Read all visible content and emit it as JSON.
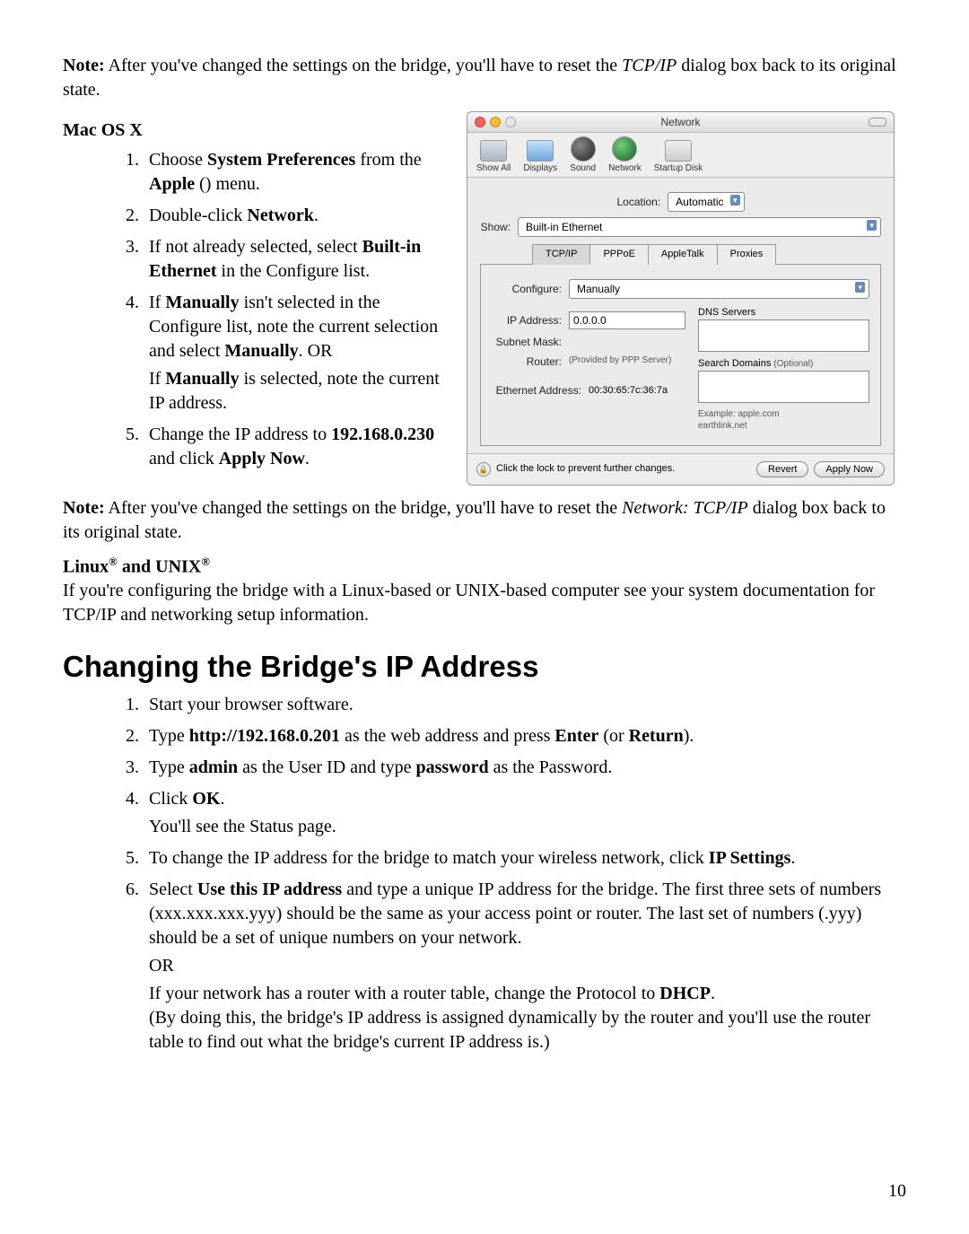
{
  "note1_prefix": "Note:",
  "note1_body": " After you've changed the settings on the bridge, you'll have to reset the ",
  "note1_italic": "TCP/IP",
  "note1_tail": " dialog box back to its original state.",
  "mac_hdr": "Mac OS X",
  "mac_steps_1a": "Choose ",
  "mac_steps_1b": "System Preferences",
  "mac_steps_1c": " from the ",
  "mac_steps_1d": "Apple",
  "mac_steps_1e": " (",
  "mac_steps_1f": ") menu.",
  "mac_steps_2a": "Double-click ",
  "mac_steps_2b": "Network",
  "mac_steps_2c": ".",
  "mac_steps_3a": "If not already selected, select ",
  "mac_steps_3b": "Built-in Ethernet",
  "mac_steps_3c": " in the Configure list.",
  "mac_steps_4a": "If ",
  "mac_steps_4b": "Manually",
  "mac_steps_4c": " isn't selected in the Configure list, note the current selection and select ",
  "mac_steps_4d": "Manually",
  "mac_steps_4e": ". OR",
  "mac_steps_4f": "If ",
  "mac_steps_4g": "Manually",
  "mac_steps_4h": " is selected, note the current IP address.",
  "mac_steps_5a": "Change the IP address to ",
  "mac_steps_5b": "192.168.0.230",
  "mac_steps_5c": " and click ",
  "mac_steps_5d": "Apply Now",
  "mac_steps_5e": ".",
  "note2_prefix": "Note:",
  "note2_body": " After you've changed the settings on the bridge, you'll have to reset the ",
  "note2_italic": "Network: TCP/IP",
  "note2_tail": " dialog box back to its original state.",
  "linux_hdr_a": "Linux",
  "linux_hdr_b": " and UNIX",
  "linux_body": "If you're configuring the bridge with a Linux-based or UNIX-based computer see your system documentation for TCP/IP and networking setup information.",
  "big_heading": "Changing the Bridge's IP Address",
  "ch_steps_1": "Start your browser software.",
  "ch_steps_2a": "Type ",
  "ch_steps_2b": "http://192.168.0.201",
  "ch_steps_2c": " as the web address and press ",
  "ch_steps_2d": "Enter",
  "ch_steps_2e": " (or ",
  "ch_steps_2f": "Return",
  "ch_steps_2g": ").",
  "ch_steps_3a": "Type ",
  "ch_steps_3b": "admin",
  "ch_steps_3c": " as the User ID and type ",
  "ch_steps_3d": "password",
  "ch_steps_3e": " as the Password.",
  "ch_steps_4a": "Click ",
  "ch_steps_4b": "OK",
  "ch_steps_4c": ".",
  "ch_steps_4_sub": "You'll see the Status page.",
  "ch_steps_5a": "To change the IP address for the bridge to match your wireless network, click ",
  "ch_steps_5b": "IP Settings",
  "ch_steps_5c": ".",
  "ch_steps_6a": "Select ",
  "ch_steps_6b": "Use this IP address",
  "ch_steps_6c": " and type a unique IP address for the bridge. The first three sets of numbers (xxx.xxx.xxx.yyy) should be the same as your access point or router. The last set of numbers (.yyy) should be a set of unique numbers on your network.",
  "ch_steps_6_or": "OR",
  "ch_steps_6_sub_a": "If your network has a router with a router table, change the Protocol to ",
  "ch_steps_6_sub_b": "DHCP",
  "ch_steps_6_sub_c": ".",
  "ch_steps_6_sub_d": "(By doing this, the bridge's IP address is assigned dynamically by the router and you'll use the router table to find out what the bridge's current IP address is.)",
  "page_num": "10",
  "panel": {
    "title": "Network",
    "toolbar": {
      "show_all": "Show All",
      "displays": "Displays",
      "sound": "Sound",
      "network": "Network",
      "startup": "Startup Disk"
    },
    "location_label": "Location:",
    "location_value": "Automatic",
    "show_label": "Show:",
    "show_value": "Built-in Ethernet",
    "tabs": {
      "tcpip": "TCP/IP",
      "pppoe": "PPPoE",
      "appletalk": "AppleTalk",
      "proxies": "Proxies"
    },
    "configure_label": "Configure:",
    "configure_value": "Manually",
    "ip_label": "IP Address:",
    "ip_value": "0.0.0.0",
    "subnet_label": "Subnet Mask:",
    "router_label": "Router:",
    "router_hint": "(Provided by PPP Server)",
    "eth_label": "Ethernet Address:",
    "eth_value": "00:30:65:7c:36:7a",
    "dns_label": "DNS Servers",
    "search_label": "Search Domains",
    "optional": "(Optional)",
    "example_label": "Example:",
    "example_value": "apple.com\nearthlink.net",
    "lock_text": "Click the lock to prevent further changes.",
    "revert": "Revert",
    "apply": "Apply Now"
  }
}
